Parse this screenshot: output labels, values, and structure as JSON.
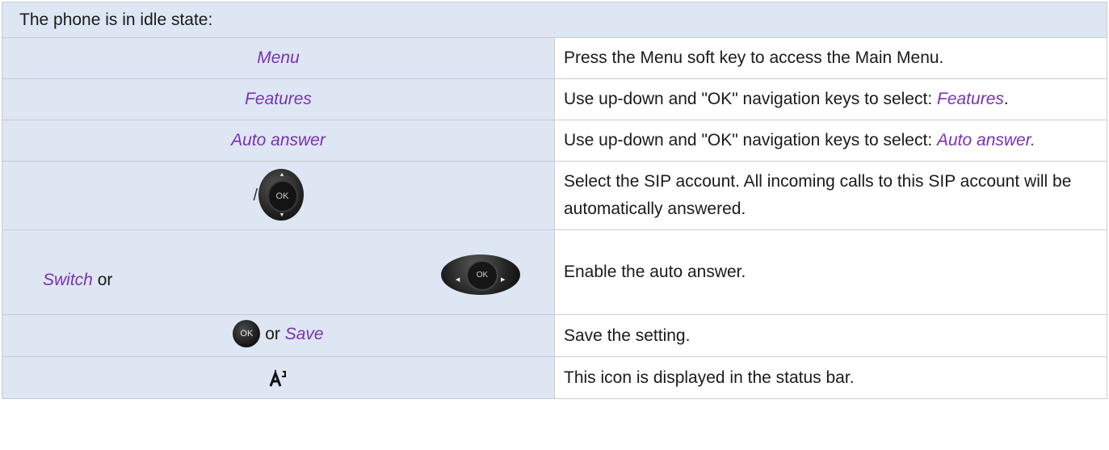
{
  "header": "The phone is in idle state:",
  "rows": [
    {
      "left": "Menu",
      "text": "Press the Menu soft key to access the Main Menu."
    },
    {
      "left": "Features",
      "text": "Use up-down and \"OK\" navigation keys to select: ",
      "emph": "Features",
      "tail": "."
    },
    {
      "left": "Auto answer",
      "text": "Use up-down and \"OK\" navigation keys to select: ",
      "emph": "Auto answer."
    },
    {
      "left_icon": "navigation-key-up-down-icon",
      "slash": "/",
      "ok": "OK",
      "text": "Select the SIP account. All incoming calls to this SIP account will be automatically answered."
    },
    {
      "left": "Switch",
      "joiner": "or",
      "left_icon": "navigation-key-left-right-icon",
      "ok": "OK",
      "text": "Enable the auto answer."
    },
    {
      "left_icon": "ok-key-icon",
      "ok": "OK",
      "joiner": "or",
      "left": "Save",
      "text": "Save the setting."
    },
    {
      "left_icon": "auto-answer-status-icon",
      "text": "This icon is displayed in the status bar."
    }
  ],
  "colors": {
    "left_bg": "#dde6f2",
    "accent": "#7a30b6",
    "border": "#c9cdd3"
  }
}
